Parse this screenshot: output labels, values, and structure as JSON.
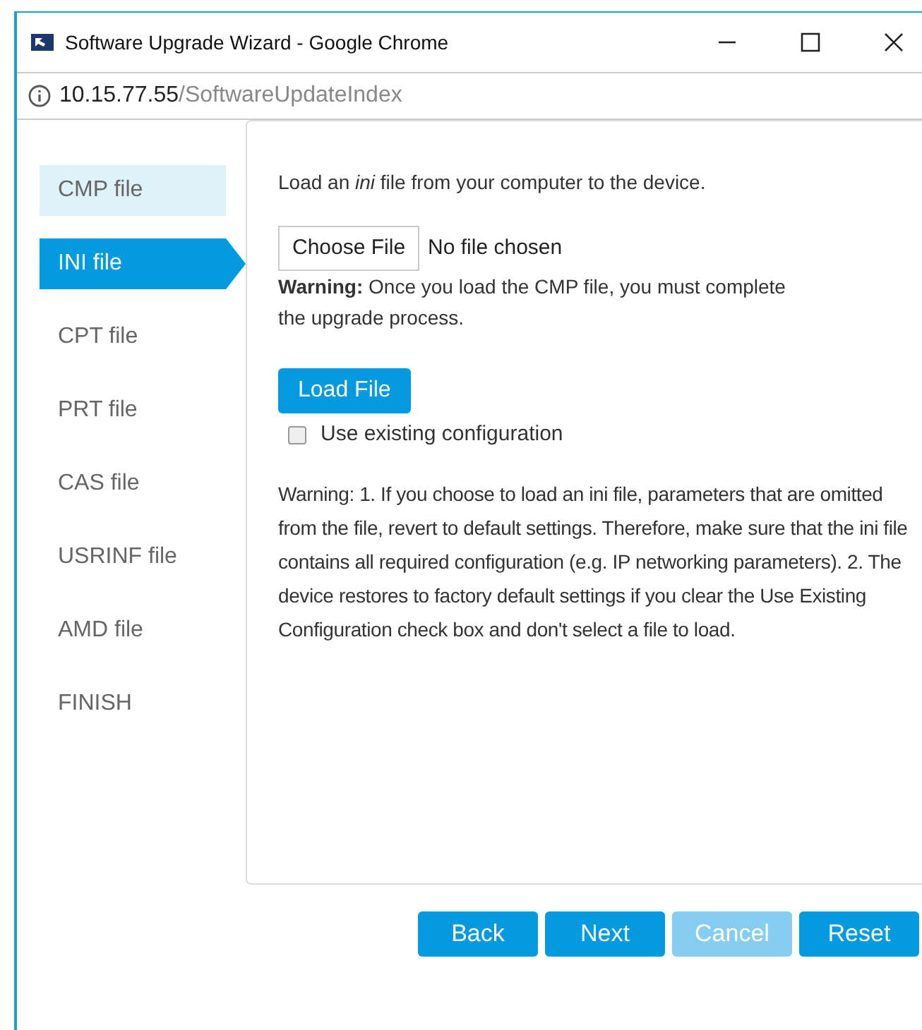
{
  "window": {
    "title": "Software Upgrade Wizard - Google Chrome"
  },
  "address": {
    "host": "10.15.77.55",
    "path": "/SoftwareUpdateIndex"
  },
  "steps": [
    {
      "label": "CMP file",
      "selected": false,
      "done": true
    },
    {
      "label": "INI file",
      "selected": true,
      "done": false
    },
    {
      "label": "CPT file",
      "selected": false,
      "done": false
    },
    {
      "label": "PRT file",
      "selected": false,
      "done": false
    },
    {
      "label": "CAS file",
      "selected": false,
      "done": false
    },
    {
      "label": "USRINF file",
      "selected": false,
      "done": false
    },
    {
      "label": "AMD file",
      "selected": false,
      "done": false
    },
    {
      "label": "FINISH",
      "selected": false,
      "done": false
    }
  ],
  "intro": "Load an *ini* file from your computer to the device.",
  "file_input": {
    "button": "Choose File",
    "status": "No file chosen"
  },
  "warning": "**Warning:** Once you load the CMP file, you must complete the upgrade process.",
  "load_button": "Load File",
  "use_existing": {
    "label": "Use existing configuration",
    "checked": false
  },
  "note": "Warning: 1. If you choose to load an ini file, parameters that are omitted from the file, revert to default settings. Therefore, make sure that the ini file contains all required configuration (e.g. IP networking parameters). 2. The device restores to factory default settings if you clear the Use Existing Configuration check box and don't select a file to load.",
  "buttons": [
    {
      "label": "Back",
      "disabled": false
    },
    {
      "label": "Next",
      "disabled": false
    },
    {
      "label": "Cancel",
      "disabled": true
    },
    {
      "label": "Reset",
      "disabled": false
    }
  ]
}
